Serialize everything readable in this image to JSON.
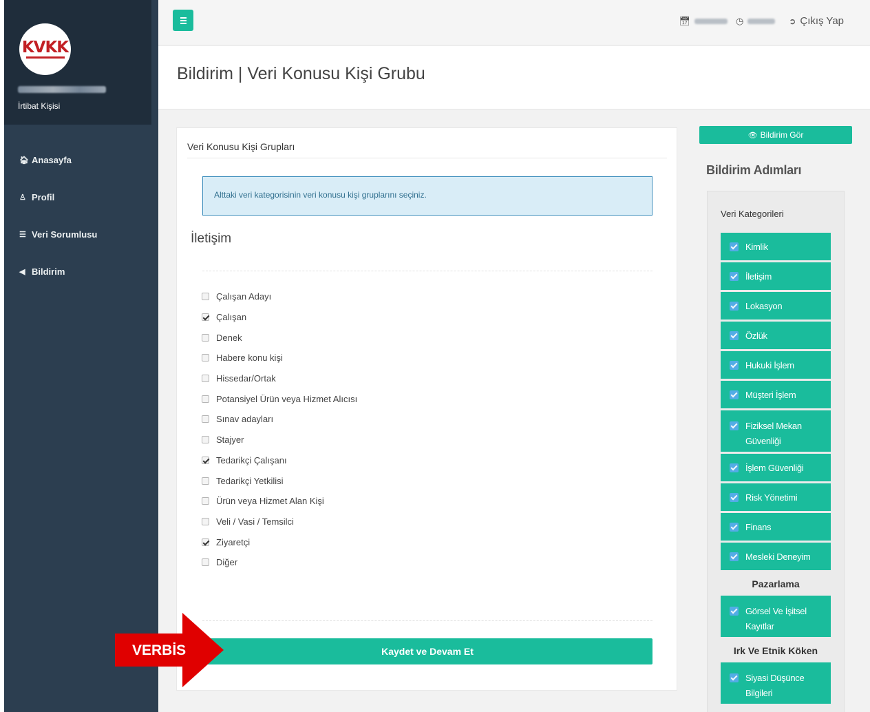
{
  "sidebar": {
    "logo_text": "KVKK",
    "profile_role": "İrtibat Kişisi",
    "items": [
      {
        "label": "Anasayfa",
        "icon": "home-icon"
      },
      {
        "label": "Profil",
        "icon": "user-icon"
      },
      {
        "label": "Veri Sorumlusu",
        "icon": "database-icon"
      },
      {
        "label": "Bildirim",
        "icon": "bullhorn-icon"
      }
    ]
  },
  "topbar": {
    "logout_label": "Çıkış Yap"
  },
  "page": {
    "title": "Bildirim | Veri Konusu Kişi Grubu"
  },
  "card": {
    "title": "Veri Konusu Kişi Grupları",
    "alert": "Alttaki veri kategorisinin veri konusu kişi gruplarını seçiniz.",
    "section_title": "İletişim",
    "options": [
      {
        "label": "Çalışan Adayı",
        "checked": false
      },
      {
        "label": "Çalışan",
        "checked": true
      },
      {
        "label": "Denek",
        "checked": false
      },
      {
        "label": "Habere konu kişi",
        "checked": false
      },
      {
        "label": "Hissedar/Ortak",
        "checked": false
      },
      {
        "label": "Potansiyel Ürün veya Hizmet Alıcısı",
        "checked": false
      },
      {
        "label": "Sınav adayları",
        "checked": false
      },
      {
        "label": "Stajyer",
        "checked": false
      },
      {
        "label": "Tedarikçi Çalışanı",
        "checked": true
      },
      {
        "label": "Tedarikçi Yetkilisi",
        "checked": false
      },
      {
        "label": "Ürün veya Hizmet Alan Kişi",
        "checked": false
      },
      {
        "label": "Veli / Vasi / Temsilci",
        "checked": false
      },
      {
        "label": "Ziyaretçi",
        "checked": true
      },
      {
        "label": "Diğer",
        "checked": false
      }
    ],
    "save_label": "Kaydet ve Devam Et"
  },
  "annotation": {
    "arrow_label": "VERBİS",
    "arrow_color": "#e00000"
  },
  "right_panel": {
    "view_button_label": "Bildirim Gör",
    "steps_title": "Bildirim Adımları",
    "panel_title": "Veri Kategorileri",
    "steps": [
      {
        "type": "step",
        "label": "Kimlik"
      },
      {
        "type": "step",
        "label": "İletişim"
      },
      {
        "type": "step",
        "label": "Lokasyon"
      },
      {
        "type": "step",
        "label": "Özlük"
      },
      {
        "type": "step",
        "label": "Hukuki İşlem"
      },
      {
        "type": "step",
        "label": "Müşteri İşlem"
      },
      {
        "type": "step",
        "label": "Fiziksel Mekan Güvenliği",
        "tall": true
      },
      {
        "type": "step",
        "label": "İşlem Güvenliği"
      },
      {
        "type": "step",
        "label": "Risk Yönetimi"
      },
      {
        "type": "step",
        "label": "Finans"
      },
      {
        "type": "step",
        "label": "Mesleki Deneyim"
      },
      {
        "type": "group",
        "label": "Pazarlama"
      },
      {
        "type": "step",
        "label": "Görsel Ve İşitsel Kayıtlar",
        "tall": true
      },
      {
        "type": "group",
        "label": "Irk Ve Etnik Köken"
      },
      {
        "type": "step",
        "label": "Siyasi Düşünce Bilgileri",
        "tall": true
      }
    ]
  },
  "colors": {
    "accent": "#1abc9c",
    "sidebar": "#2c3e50",
    "alert_bg": "#d9edf7"
  }
}
